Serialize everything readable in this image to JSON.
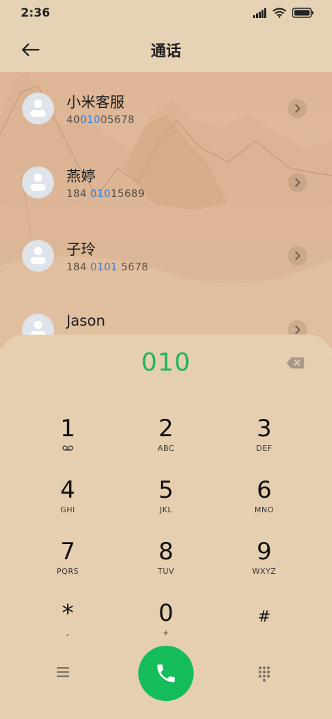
{
  "status_bar": {
    "time": "2:36"
  },
  "header": {
    "title": "通话"
  },
  "contacts": [
    {
      "name": "小米客服",
      "number_pre": "40",
      "number_hl": "010",
      "number_post": "05678"
    },
    {
      "name": "燕婷",
      "number_pre": "184 ",
      "number_hl": "010",
      "number_post": "15689"
    },
    {
      "name": "子玲",
      "number_pre": "184 ",
      "number_hl": "0101",
      "number_post": " 5678"
    },
    {
      "name": "Jason",
      "number_pre": "",
      "number_hl": "",
      "number_post": ""
    }
  ],
  "dialer": {
    "input": "010",
    "keys": [
      {
        "digit": "1",
        "letters": ""
      },
      {
        "digit": "2",
        "letters": "ABC"
      },
      {
        "digit": "3",
        "letters": "DEF"
      },
      {
        "digit": "4",
        "letters": "GHI"
      },
      {
        "digit": "5",
        "letters": "JKL"
      },
      {
        "digit": "6",
        "letters": "MNO"
      },
      {
        "digit": "7",
        "letters": "PQRS"
      },
      {
        "digit": "8",
        "letters": "TUV"
      },
      {
        "digit": "9",
        "letters": "WXYZ"
      },
      {
        "digit": "*",
        "letters": ","
      },
      {
        "digit": "0",
        "letters": "+"
      },
      {
        "digit": "#",
        "letters": ""
      }
    ]
  },
  "colors": {
    "accent_green": "#1fb55b",
    "call_button": "#14bd5a",
    "highlight_blue": "#3d7fd6",
    "background": "#e6cfb0"
  },
  "icons": {
    "back": "arrow-left-icon",
    "voicemail": "voicemail-icon",
    "backspace": "backspace-icon",
    "menu": "menu-icon",
    "call": "phone-icon",
    "keypad": "keypad-icon"
  }
}
